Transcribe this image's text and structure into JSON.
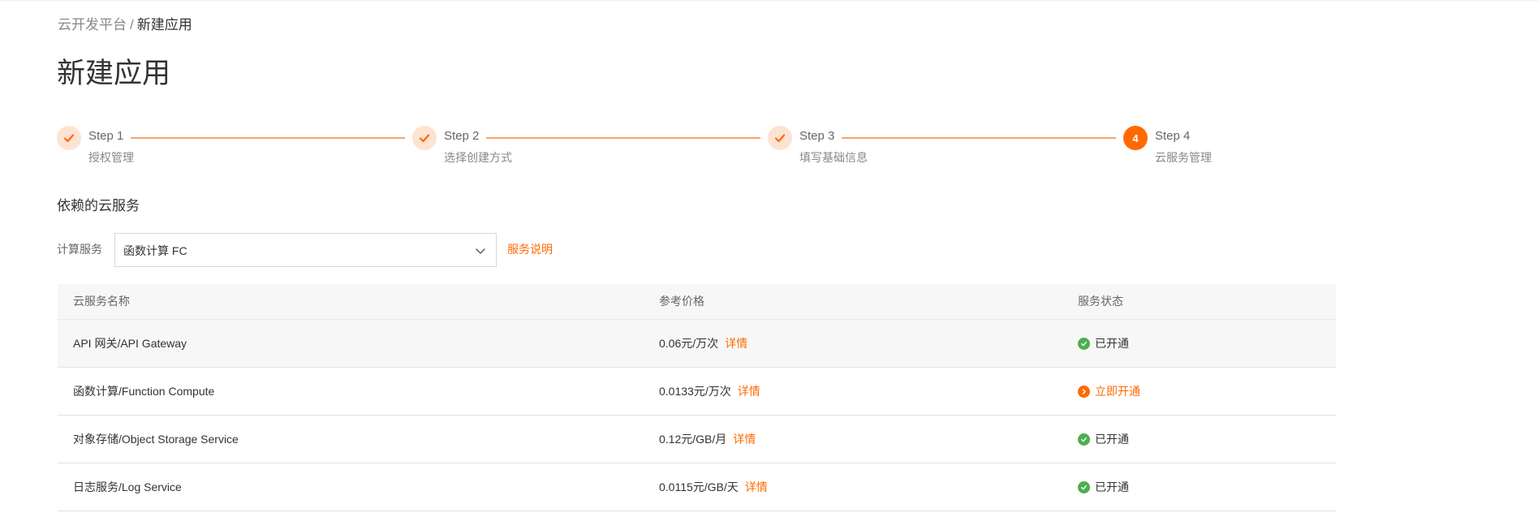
{
  "breadcrumb": {
    "parent": "云开发平台",
    "separator": "/",
    "current": "新建应用"
  },
  "page_title": "新建应用",
  "steps": [
    {
      "title": "Step 1",
      "desc": "授权管理",
      "status": "done",
      "icon": "check-icon"
    },
    {
      "title": "Step 2",
      "desc": "选择创建方式",
      "status": "done",
      "icon": "check-icon"
    },
    {
      "title": "Step 3",
      "desc": "填写基础信息",
      "status": "done",
      "icon": "check-icon"
    },
    {
      "title": "Step 4",
      "desc": "云服务管理",
      "status": "current",
      "number": "4"
    }
  ],
  "section_title": "依赖的云服务",
  "compute": {
    "label": "计算服务",
    "selected": "函数计算 FC",
    "help_link": "服务说明"
  },
  "table": {
    "headers": [
      "云服务名称",
      "参考价格",
      "服务状态"
    ],
    "detail_label": "详情",
    "rows": [
      {
        "name": "API 网关/API Gateway",
        "price": "0.06元/万次",
        "status": "已开通",
        "state": "enabled"
      },
      {
        "name": "函数计算/Function Compute",
        "price": "0.0133元/万次",
        "status": "立即开通",
        "state": "action"
      },
      {
        "name": "对象存储/Object Storage Service",
        "price": "0.12元/GB/月",
        "status": "已开通",
        "state": "enabled"
      },
      {
        "name": "日志服务/Log Service",
        "price": "0.0115元/GB/天",
        "status": "已开通",
        "state": "enabled"
      }
    ]
  },
  "colors": {
    "accent": "#ff6a00",
    "success": "#4caf50",
    "step_done_bg": "#fde3d2",
    "step_line": "#f7a46d"
  }
}
